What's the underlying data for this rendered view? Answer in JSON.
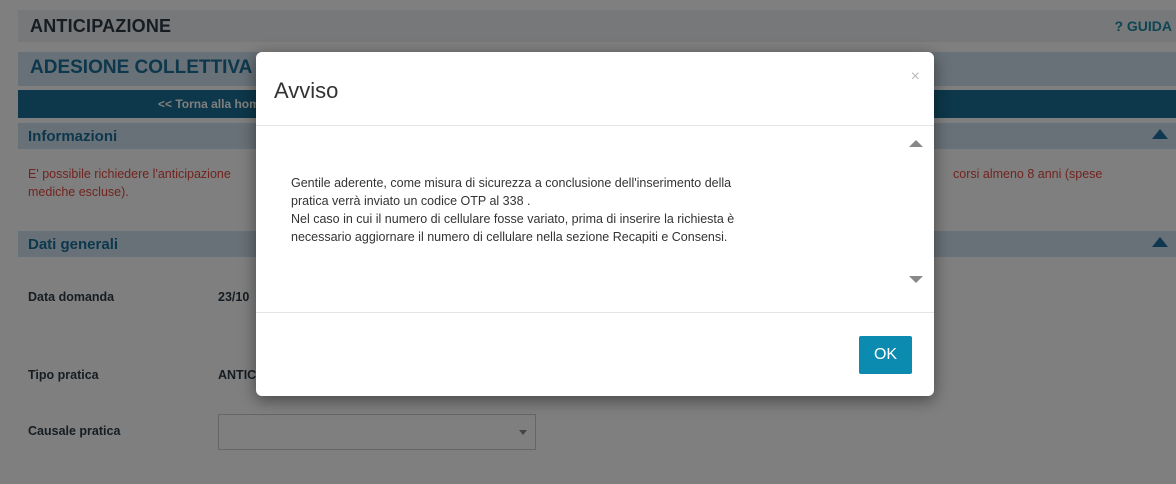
{
  "header": {
    "title": "ANTICIPAZIONE",
    "guide_link": "? GUIDA"
  },
  "section": {
    "title": "ADESIONE COLLETTIVA -"
  },
  "back_button": {
    "label": "<< Torna alla home"
  },
  "panels": {
    "info": {
      "label": "Informazioni"
    },
    "general": {
      "label": "Dati generali"
    }
  },
  "info_text": {
    "line1": "E' possibile richiedere l'anticipazione",
    "line2": "mediche escluse).",
    "line1_right": "corsi almeno 8 anni (spese"
  },
  "form": {
    "date_label": "Data domanda",
    "date_value": "23/10",
    "type_label": "Tipo pratica",
    "type_value": "ANTIC",
    "reason_label": "Causale pratica",
    "reason_value": ""
  },
  "modal": {
    "title": "Avviso",
    "close_icon": "×",
    "body": "Gentile aderente, come misura di sicurezza a conclusione dell'inserimento della\npratica verrà inviato un codice OTP al 338            .\nNel caso in cui il numero di cellulare fosse variato, prima di inserire la richiesta è\nnecessario aggiornare il numero di cellulare nella sezione Recapiti e Consensi.",
    "ok_label": "OK"
  },
  "colors": {
    "accent": "#0b8bb0",
    "panel_header": "#cfe3ee",
    "warning_text": "#e5473e",
    "nav_button": "#1a6f95"
  },
  "icons": {
    "collapse": "triangle-up-icon",
    "scroll_up": "triangle-up-icon",
    "scroll_down": "triangle-down-icon",
    "close": "close-icon"
  }
}
